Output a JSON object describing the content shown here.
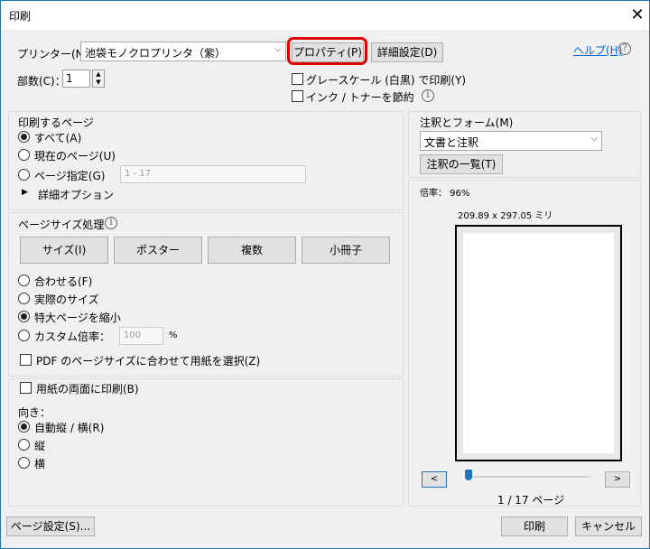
{
  "window": {
    "title": "印刷",
    "close_glyph": "✕"
  },
  "printer": {
    "label": "プリンター(N)：",
    "selected": "池袋モノクロプリンタ（紫）",
    "properties_button": "プロパティ(P)",
    "advanced_button": "詳細設定(D)",
    "help_link": "ヘルプ(H)",
    "copies_label": "部数(C)：",
    "copies_value": "1",
    "grayscale_label": "グレースケール (白黒) で印刷(Y)",
    "save_ink_label": "インク / トナーを節約"
  },
  "pages_section": {
    "heading": "印刷するページ",
    "all": "すべて(A)",
    "current": "現在のページ(U)",
    "range": "ページ指定(G)",
    "range_placeholder": "1 - 17",
    "more_options": "詳細オプション"
  },
  "sizing_section": {
    "heading": "ページサイズ処理",
    "buttons": [
      "サイズ(I)",
      "ポスター",
      "複数",
      "小冊子"
    ],
    "fit": "合わせる(F)",
    "actual": "実際のサイズ",
    "shrink": "特大ページを縮小",
    "custom": "カスタム倍率：",
    "custom_value": "100",
    "percent": "%",
    "choose_paper": "PDF のページサイズに合わせて用紙を選択(Z)"
  },
  "duplex_section": {
    "duplex_label": "用紙の両面に印刷(B)",
    "orientation_heading": "向き：",
    "auto": "自動縦 / 横(R)",
    "portrait": "縦",
    "landscape": "横"
  },
  "comments_section": {
    "heading": "注釈とフォーム(M)",
    "selected": "文書と注釈",
    "summary_button": "注釈の一覧(T)"
  },
  "preview": {
    "scale": "倍率： 96%",
    "dimensions": "209.89 x 297.05 ミリ",
    "prev": "<",
    "next": ">",
    "page_indicator": "1 / 17 ページ",
    "current_page": 1,
    "total_pages": 17
  },
  "footer": {
    "page_setup": "ページ設定(S)...",
    "print": "印刷",
    "cancel": "キャンセル"
  },
  "colors": {
    "highlight": "#e00000",
    "link": "#0066cc"
  }
}
